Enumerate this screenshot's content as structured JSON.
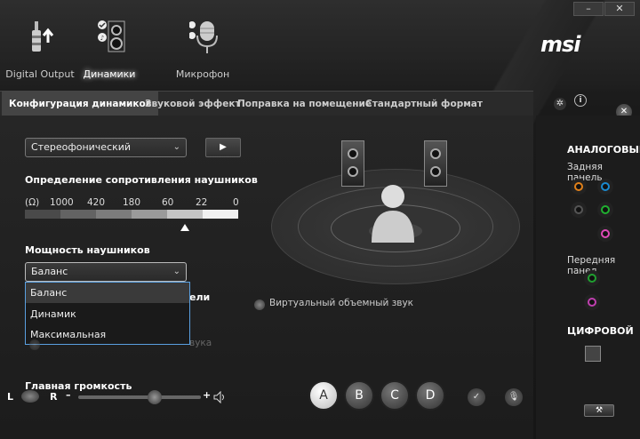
{
  "window": {
    "minimize": "–",
    "close": "✕"
  },
  "devices": [
    {
      "label": "Digital Output",
      "icon": "plug-icon"
    },
    {
      "label": "Динамики",
      "icon": "speaker-icon"
    },
    {
      "label": "Микрофон",
      "icon": "microphone-icon"
    }
  ],
  "brand": "msi",
  "tabs": [
    {
      "label": "Конфигурация динамиков"
    },
    {
      "label": "Звуковой эффект"
    },
    {
      "label": "Поправка на помещение"
    },
    {
      "label": "Стандартный формат"
    }
  ],
  "config": {
    "mode_select": "Стереофонический",
    "play": "▶",
    "impedance_title": "Определение сопротивления наушников",
    "impedance_unit": "(Ω)",
    "impedance_values": [
      "1000",
      "420",
      "180",
      "60",
      "22",
      "0"
    ],
    "power_title": "Мощность наушников",
    "power_select": "Баланс",
    "power_options": [
      "Баланс",
      "Динамик",
      "Максимальная"
    ],
    "hidden_text_1": "ели",
    "hidden_text_2": "вука",
    "virtual_surround": "Виртуальный объемный звук"
  },
  "volume": {
    "label": "Главная громкость",
    "left": "L",
    "right": "R",
    "minus": "–",
    "plus": "+",
    "level": 0.62
  },
  "presets": [
    "A",
    "B",
    "C",
    "D"
  ],
  "side": {
    "analog": "АНАЛОГОВЫЙ",
    "rear": "Задняя панель",
    "front": "Передняя панел",
    "digital": "ЦИФРОВОЙ",
    "jack_colors": [
      "#e0801a",
      "#1a8ad0",
      "#555555",
      "#20b030",
      "#e04ab8",
      "#20a030",
      "#c040b0"
    ]
  }
}
